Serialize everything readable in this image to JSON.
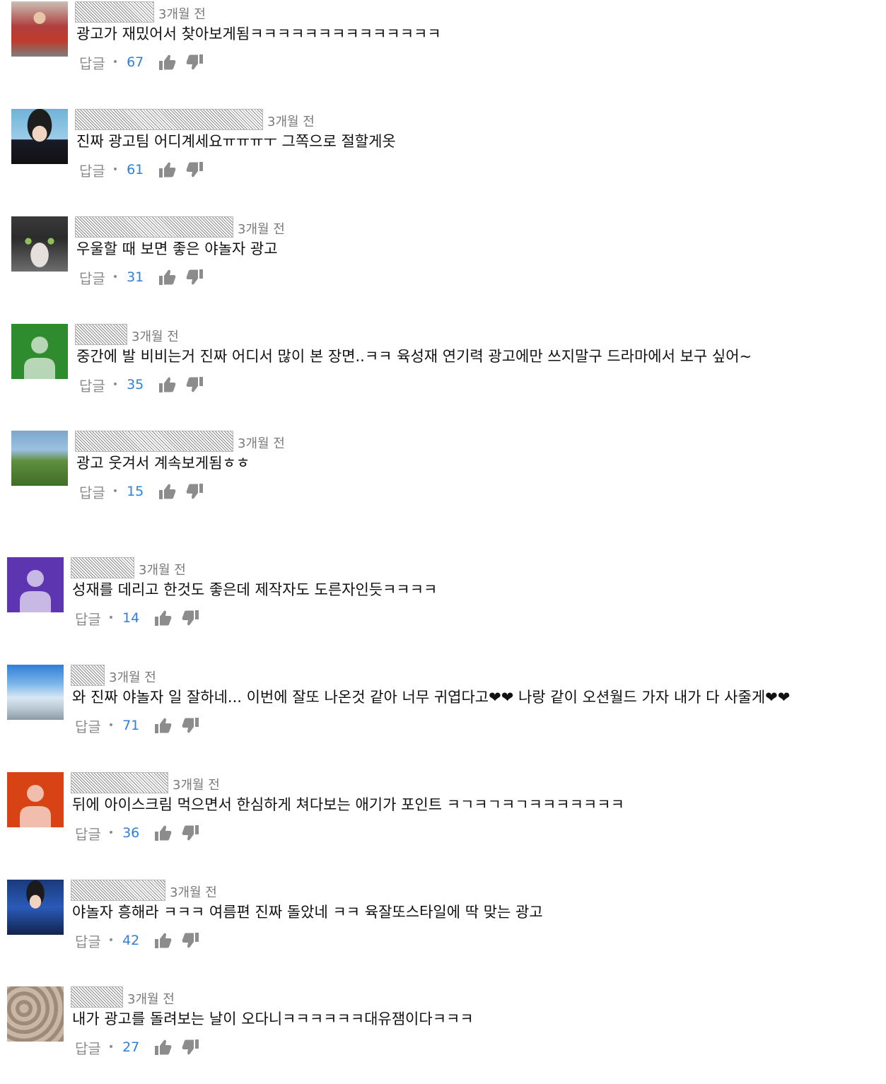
{
  "comments": [
    {
      "time": "3개월 전",
      "text": "광고가 재밌어서 찾아보게됨ㅋㅋㅋㅋㅋㅋㅋㅋㅋㅋㅋㅋㅋㅋ",
      "reply": "답글",
      "likes": "67",
      "avatar": "photo-red-jacket"
    },
    {
      "time": "3개월 전",
      "text": "진짜 광고팀 어디계세요ㅠㅠㅠㅜ 그쪽으로 절할게옷",
      "reply": "답글",
      "likes": "61",
      "avatar": "photo-portrait"
    },
    {
      "time": "3개월 전",
      "text": "우울할 때 보면 좋은 야놀자 광고",
      "reply": "답글",
      "likes": "31",
      "avatar": "photo-cat"
    },
    {
      "time": "3개월 전",
      "text": "중간에 발 비비는거 진짜 어디서 많이 본 장면..ㅋㅋ 육성재 연기력 광고에만 쓰지말구 드라마에서 보구 싶어~",
      "reply": "답글",
      "likes": "35",
      "avatar": "default-green",
      "color": "#2e8b2e"
    },
    {
      "time": "3개월 전",
      "text": "광고 웃겨서 계속보게됨ㅎㅎ",
      "reply": "답글",
      "likes": "15",
      "avatar": "photo-golf"
    },
    {
      "time": "3개월 전",
      "text": "성재를 데리고 한것도 좋은데 제작자도 도른자인듯ㅋㅋㅋㅋ",
      "reply": "답글",
      "likes": "14",
      "avatar": "default-purple",
      "color": "#5e35b1"
    },
    {
      "time": "3개월 전",
      "text": "와 진짜  야놀자 일 잘하네... 이번에 잘또 나온것 같아 너무 귀엽다고❤❤ 나랑 같이 오션월드 가자 내가 다 사줄게❤❤",
      "reply": "답글",
      "likes": "71",
      "avatar": "photo-sky"
    },
    {
      "time": "3개월 전",
      "text": "뒤에 아이스크림 먹으면서 한심하게 쳐다보는 애기가 포인트 ㅋㄱㅋㄱㅋㄱㅋㅋㅋㅋㅋㅋㅋ",
      "reply": "답글",
      "likes": "36",
      "avatar": "default-orange",
      "color": "#d84315"
    },
    {
      "time": "3개월 전",
      "text": "야놀자 흥해라 ㅋㅋㅋ 여름편 진짜 돌았네 ㅋㅋ 육잘또스타일에 딱 맞는 광고",
      "reply": "답글",
      "likes": "42",
      "avatar": "photo-stage"
    },
    {
      "time": "3개월 전",
      "text": "내가 광고를 돌려보는 날이 오다니ㅋㅋㅋㅋㅋㅋ대유잼이다ㅋㅋㅋ",
      "reply": "답글",
      "likes": "27",
      "avatar": "photo-texture"
    }
  ]
}
